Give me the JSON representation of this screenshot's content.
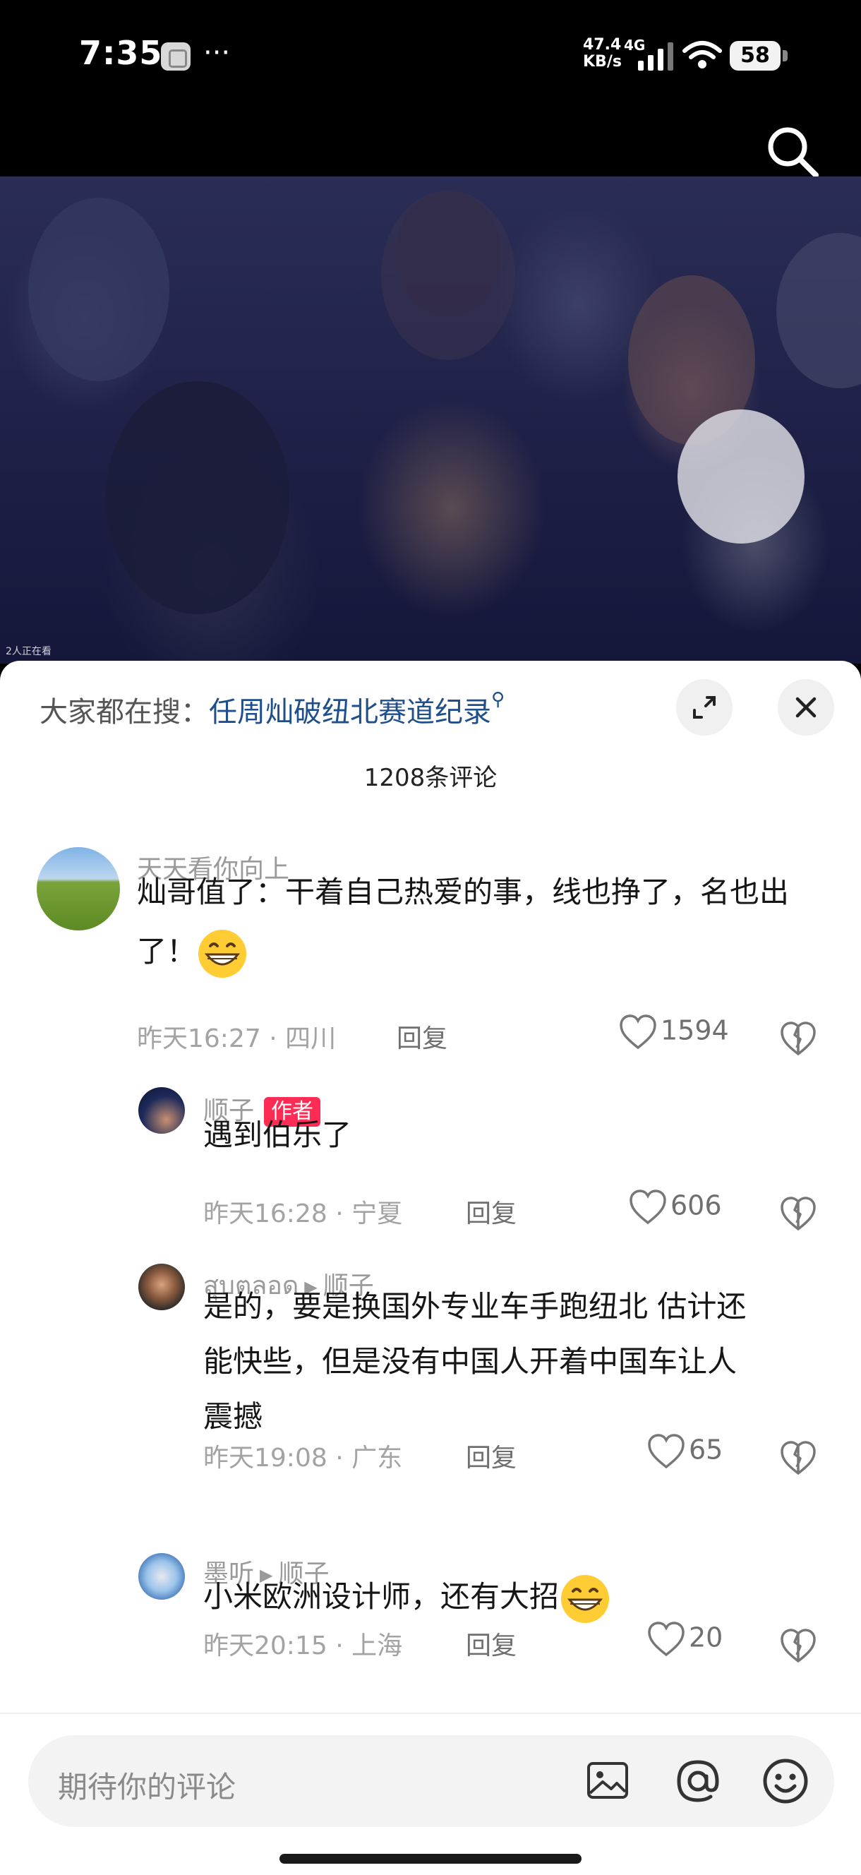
{
  "status_bar": {
    "time": "7:35",
    "dots": "···",
    "net_speed": "47.4",
    "net_speed_unit": "KB/s",
    "network": "4G",
    "battery": "58"
  },
  "video": {
    "watching_text": "2人正在看"
  },
  "sheet": {
    "hot_search_label": "大家都在搜：",
    "hot_search_link": "任周灿破纽北赛道纪录",
    "comment_count": "1208条评论"
  },
  "comments": [
    {
      "username": "天天看你向上",
      "text": "灿哥值了：干着自己热爱的事，线也挣了，名也出了！",
      "time": "昨天16:27",
      "location": "四川",
      "reply_label": "回复",
      "likes": "1594"
    },
    {
      "username": "顺子",
      "author_tag": "作者",
      "text": "遇到伯乐了",
      "time": "昨天16:28",
      "location": "宁夏",
      "reply_label": "回复",
      "likes": "606"
    },
    {
      "username": "สุบตลอด",
      "reply_to": "顺子",
      "text_line1": "是的，要是换国外专业车手跑纽北 估计还",
      "text_line2": "能快些，但是没有中国人开着中国车让人",
      "text_line3": "震撼",
      "time": "昨天19:08",
      "location": "广东",
      "reply_label": "回复",
      "likes": "65"
    },
    {
      "username": "墨听",
      "reply_to": "顺子",
      "text": "小米欧洲设计师，还有大招",
      "time": "昨天20:15",
      "location": "上海",
      "reply_label": "回复",
      "likes": "20"
    }
  ],
  "input": {
    "placeholder": "期待你的评论"
  },
  "icons": {
    "search": "search-icon",
    "expand": "expand-icon",
    "close": "close-icon",
    "like": "heart-icon",
    "dislike": "broken-heart-icon",
    "image": "image-icon",
    "mention": "at-icon",
    "emoji": "emoji-icon"
  },
  "colors": {
    "accent_link": "#1f4e8c",
    "author_tag": "#fe2c55",
    "meta_gray": "#a3a3a3"
  }
}
